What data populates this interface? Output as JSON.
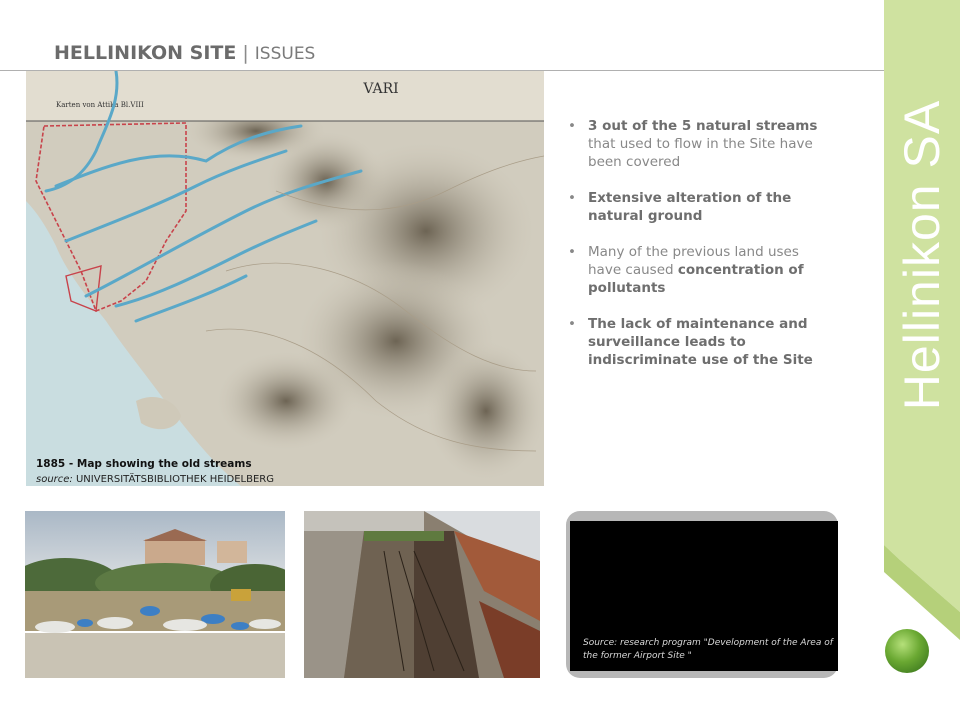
{
  "header": {
    "title": "HELLINIKON SITE",
    "separator": "|",
    "subtitle": "ISSUES"
  },
  "map": {
    "top_title": "VARI",
    "left_label": "Karten von Attika Bl.VIII",
    "caption": "1885 - Map showing the old streams",
    "source_prefix": "source:",
    "source_name": "UNIVERSITÄTSBIBLIOTHEK HEIDELBERG"
  },
  "bullets": [
    {
      "bold": "3 out of the 5 natural streams",
      "text": " that used to flow in the Site  have been covered",
      "bold_end": ""
    },
    {
      "bold": "Extensive alteration of the natural ground",
      "text": "",
      "bold_end": ""
    },
    {
      "bold": "",
      "text": "Many of the previous land uses have caused ",
      "bold_end": "concentration of pollutants"
    },
    {
      "bold": "The lack of maintenance and surveillance leads to indiscriminate use of the Site",
      "text": "",
      "bold_end": ""
    }
  ],
  "photo3": {
    "source": "Source: research program  \"Development of the Area       of the former Airport Site \""
  },
  "brand": {
    "name": "Hellinikon SA"
  },
  "colors": {
    "brand_green": "#cfe2a0",
    "brand_green_dark": "#b5d07a",
    "stream_blue": "#5aa8c8",
    "title_gray": "#6b6b6b",
    "text_gray": "#888888"
  }
}
